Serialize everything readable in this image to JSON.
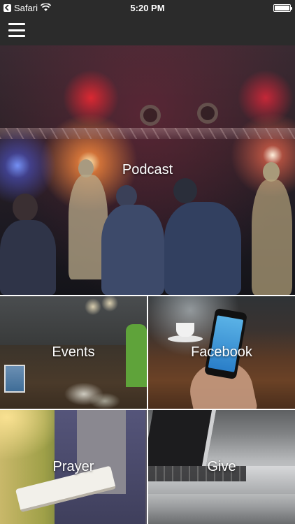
{
  "status_bar": {
    "carrier": "Safari",
    "time": "5:20 PM"
  },
  "nav": {
    "menu_icon": "hamburger-menu-icon"
  },
  "tiles": [
    {
      "label": "Podcast"
    },
    {
      "label": "Events"
    },
    {
      "label": "Facebook"
    },
    {
      "label": "Prayer"
    },
    {
      "label": "Give"
    }
  ]
}
